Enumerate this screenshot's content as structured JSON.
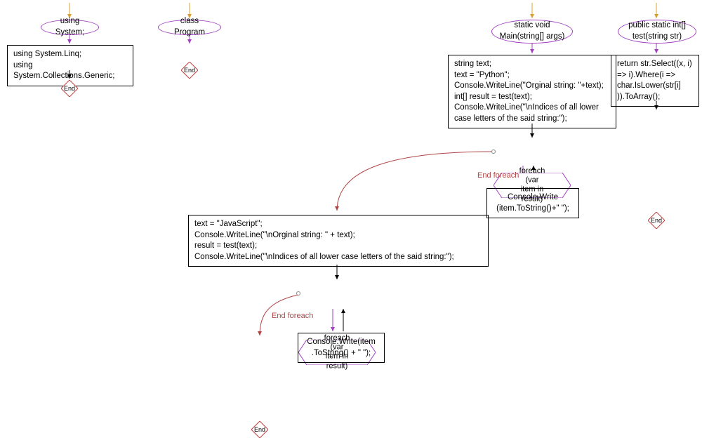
{
  "end_label": "End",
  "node1": {
    "ellipse": "using System;",
    "rect": "using System.Linq;\nusing System.Collections.Generic;"
  },
  "node2": {
    "ellipse": "class Program"
  },
  "node3": {
    "ellipse": "static void\nMain(string[] args)",
    "rect": "string text;\ntext = \"Python\";\nConsole.WriteLine(\"Orginal string: \"+text);\nint[] result = test(text);\nConsole.WriteLine(\"\\nIndices of all lower\ncase letters of the said string:\");",
    "hex1": "foreach (var\nitem in result)",
    "box_right": "Console.Write\n(item.ToString()+\" \");",
    "end_foreach": "End foreach",
    "rect2": "text = \"JavaScript\";\nConsole.WriteLine(\"\\nOrginal string: \" + text);\nresult = test(text);\nConsole.WriteLine(\"\\nIndices of all lower case letters of the said string:\");",
    "hex2": "foreach (var\nitem in result)",
    "box_right2": "Console.Write(item\n.ToString() + \" \");",
    "end_foreach2": "End foreach"
  },
  "node4": {
    "ellipse": "public static int[]\ntest(string str)",
    "rect": "return str.Select((x, i)\n=> i).Where(i =>\nchar.IsLower(str[i]\n)).ToArray();"
  }
}
